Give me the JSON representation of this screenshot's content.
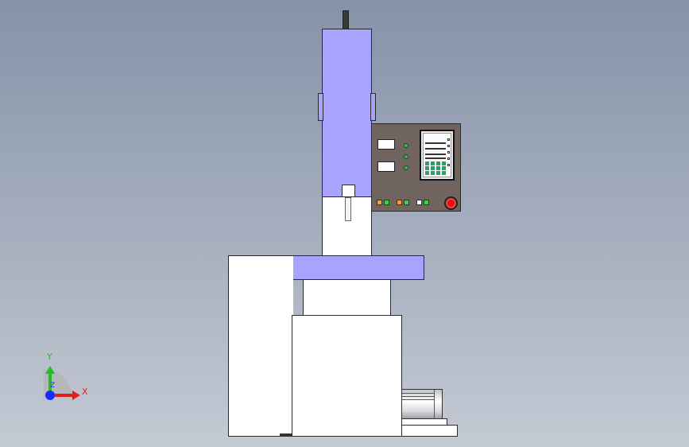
{
  "triad": {
    "x_label": "X",
    "y_label": "Y",
    "z_label": "Z",
    "x_color": "#e02020",
    "y_color": "#20c020",
    "z_color": "#1a2aff"
  },
  "colors": {
    "column": "#a7a3ff",
    "panel": "#6f655e",
    "estop": "#e01010",
    "background_top": "#8593a8",
    "background_bottom": "#c4cad4"
  }
}
